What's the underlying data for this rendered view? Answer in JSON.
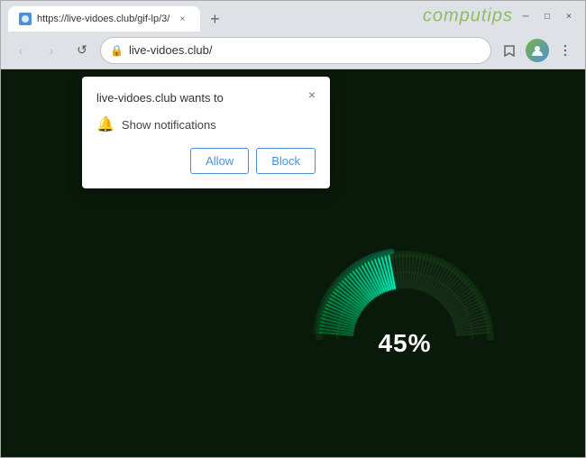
{
  "browser": {
    "tab": {
      "url_display": "https://live-vidoes.club/gif-lp/3/",
      "title": "https://live-vidoes.club/gif-lp/3/",
      "close_label": "×"
    },
    "omnibox": {
      "url": "live-vidoes.club/",
      "lock_icon": "🔒"
    },
    "brand": "computips",
    "new_tab_label": "+",
    "nav": {
      "back_label": "‹",
      "forward_label": "›",
      "refresh_label": "↺"
    },
    "controls": {
      "minimize": "─",
      "maximize": "□",
      "close": "×"
    }
  },
  "popup": {
    "title": "live-vidoes.club wants to",
    "description": "Show notifications",
    "allow_label": "Allow",
    "block_label": "Block",
    "close_label": "×"
  },
  "content": {
    "percentage": "45%"
  }
}
